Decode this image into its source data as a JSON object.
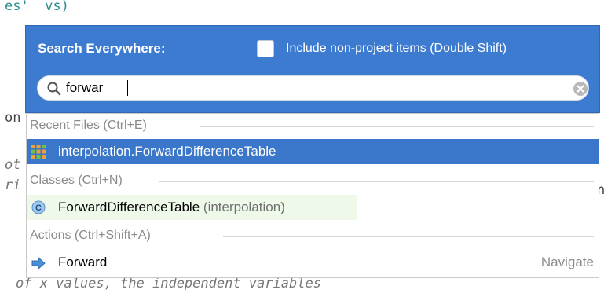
{
  "editor": {
    "line_top": "es'  vs)",
    "line_mid1": "on",
    "line_mid2": "ot",
    "line_mid3": "ri",
    "line_bottom": "of x values, the independent variables",
    "right_fragment": "n"
  },
  "popup": {
    "title": "Search Everywhere:",
    "include_checked": false,
    "include_label": "Include non-project items (Double Shift)",
    "search_value": "forwar",
    "search_icon": "search-icon",
    "clear_icon": "clear-circle-icon",
    "accent_color": "#3d7bd1"
  },
  "results": {
    "groups": [
      {
        "header": "Recent Files (Ctrl+E)",
        "items": [
          {
            "label": "interpolation.ForwardDifferenceTable",
            "icon": "class-grid-icon",
            "selected": true
          }
        ]
      },
      {
        "header": "Classes (Ctrl+N)",
        "items": [
          {
            "label": "ForwardDifferenceTable",
            "qualifier": "(interpolation)",
            "icon": "class-c-icon",
            "selected": false
          }
        ]
      },
      {
        "header": "Actions (Ctrl+Shift+A)",
        "items": [
          {
            "label": "Forward",
            "shortcut": "Navigate",
            "icon": "forward-arrow-icon",
            "selected": false
          }
        ]
      }
    ],
    "selected_color": "#3a76c9"
  }
}
